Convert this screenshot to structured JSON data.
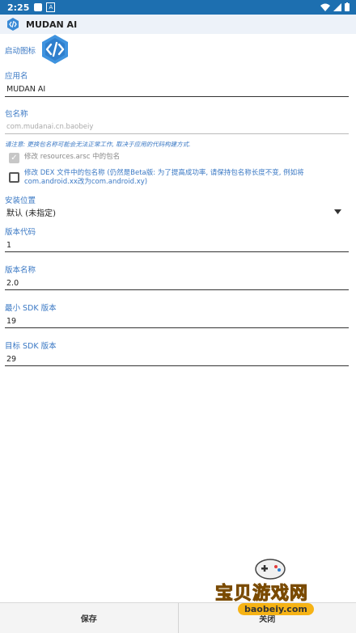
{
  "statusbar": {
    "time": "2:25"
  },
  "app": {
    "title": "MUDAN AI"
  },
  "form": {
    "icon_label": "启动图标",
    "app_name_label": "应用名",
    "app_name_value": "MUDAN AI",
    "package_label": "包名称",
    "package_placeholder": "com.mudanai.cn.baobeiy",
    "package_hint": "请注意: 更换包名称可能会无法正常工作, 取决于应用的代码构建方式.",
    "cb1_label": "修改 resources.arsc 中的包名",
    "cb1_checked": true,
    "cb2_label": "修改 DEX 文件中的包名称 (仍然是Beta版: 为了提高成功率, 请保持包名称长度不变, 例如将com.android.xx改为com.android.xy)",
    "install_label": "安装位置",
    "install_value": "默认 (未指定)",
    "version_code_label": "版本代码",
    "version_code_value": "1",
    "version_name_label": "版本名称",
    "version_name_value": "2.0",
    "min_sdk_label": "最小 SDK 版本",
    "min_sdk_value": "19",
    "target_sdk_label": "目标 SDK 版本",
    "target_sdk_value": "29"
  },
  "buttons": {
    "save": "保存",
    "close": "关闭"
  },
  "watermark": {
    "text": "宝贝游戏网",
    "url": "baobeiy.com"
  },
  "colors": {
    "accent": "#3a78c4",
    "statusbar": "#1d6fb0"
  }
}
